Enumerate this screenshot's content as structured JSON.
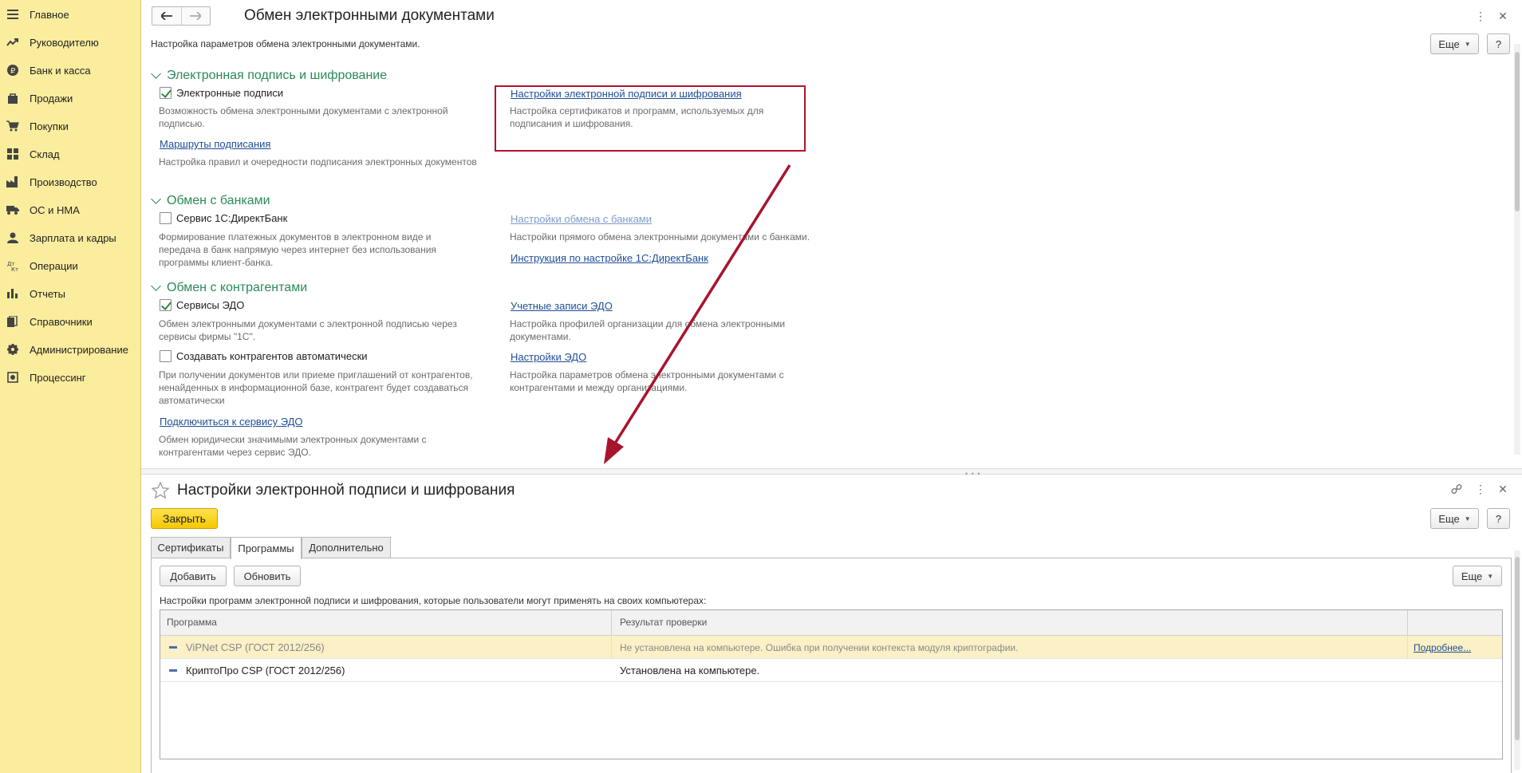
{
  "sidebar": {
    "items": [
      {
        "label": "Главное",
        "icon": "menu-icon"
      },
      {
        "label": "Руководителю",
        "icon": "trend-icon"
      },
      {
        "label": "Банк и касса",
        "icon": "ruble-icon"
      },
      {
        "label": "Продажи",
        "icon": "bag-icon"
      },
      {
        "label": "Покупки",
        "icon": "cart-icon"
      },
      {
        "label": "Склад",
        "icon": "warehouse-icon"
      },
      {
        "label": "Производство",
        "icon": "factory-icon"
      },
      {
        "label": "ОС и НМА",
        "icon": "truck-icon"
      },
      {
        "label": "Зарплата и кадры",
        "icon": "person-icon"
      },
      {
        "label": "Операции",
        "icon": "operations-icon"
      },
      {
        "label": "Отчеты",
        "icon": "chart-icon"
      },
      {
        "label": "Справочники",
        "icon": "books-icon"
      },
      {
        "label": "Администрирование",
        "icon": "gear-icon"
      },
      {
        "label": "Процессинг",
        "icon": "processing-icon"
      }
    ]
  },
  "top_form": {
    "title": "Обмен электронными документами",
    "subtitle": "Настройка параметров обмена электронными документами.",
    "more_label": "Еще",
    "help_label": "?",
    "sections": {
      "signature": {
        "title": "Электронная подпись и шифрование",
        "checkbox_label": "Электронные подписи",
        "checkbox_desc": "Возможность обмена электронными документами с электронной подписью.",
        "settings_link": "Настройки электронной подписи и шифрования",
        "settings_desc": "Настройка сертификатов и программ, используемых для подписания и шифрования.",
        "routes_link": "Маршруты подписания",
        "routes_desc": "Настройка правил и очередности подписания электронных документов"
      },
      "banks": {
        "title": "Обмен с банками",
        "checkbox_label": "Сервис 1С:ДиректБанк",
        "checkbox_desc": "Формирование платежных документов в электронном виде и передача в банк напрямую через интернет без использования программы клиент-банка.",
        "settings_link": "Настройки обмена с банками",
        "settings_desc": "Настройки прямого обмена электронными документами с банками.",
        "instruction_link": "Инструкция по настройке 1С:ДиректБанк"
      },
      "counterparties": {
        "title": "Обмен с контрагентами",
        "edo_label": "Сервисы ЭДО",
        "edo_desc": "Обмен электронными документами с электронной подписью через сервисы фирмы \"1С\".",
        "auto_label": "Создавать контрагентов автоматически",
        "auto_desc": "При получении документов или приеме приглашений от контрагентов, ненайденных в информационной базе, контрагент будет создаваться автоматически",
        "connect_link": "Подключиться к сервису ЭДО",
        "connect_desc": "Обмен юридически значимыми электронных документами с контрагентами через сервис ЭДО.",
        "accounts_link": "Учетные записи ЭДО",
        "accounts_desc": "Настройка профилей организации для обмена электронными документами.",
        "edo_settings_link": "Настройки ЭДО",
        "edo_settings_desc": "Настройка параметров обмена электронными документами с контрагентами и между организациями."
      }
    }
  },
  "bottom_form": {
    "title": "Настройки электронной подписи и шифрования",
    "close_label": "Закрыть",
    "more_label": "Еще",
    "help_label": "?",
    "tabs": [
      {
        "label": "Сертификаты"
      },
      {
        "label": "Программы"
      },
      {
        "label": "Дополнительно"
      }
    ],
    "add_label": "Добавить",
    "refresh_label": "Обновить",
    "panel_more_label": "Еще",
    "info_text": "Настройки программ электронной подписи и шифрования, которые пользователи могут применять на своих компьютерах:",
    "table": {
      "columns": [
        "Программа",
        "Результат проверки",
        ""
      ],
      "rows": [
        {
          "program": "ViPNet CSP (ГОСТ 2012/256)",
          "result": "Не установлена на компьютере. Ошибка при получении контекста модуля криптографии.",
          "details": "Подробнее..."
        },
        {
          "program": "КриптоПро CSP (ГОСТ 2012/256)",
          "result": "Установлена на компьютере.",
          "details": ""
        }
      ]
    }
  },
  "colors": {
    "sidebar_bg": "#fbed9e",
    "section_green": "#2a8a57",
    "link_blue": "#1f4e96",
    "highlight_red": "#b3122b",
    "close_yellow": "#f5c900"
  }
}
